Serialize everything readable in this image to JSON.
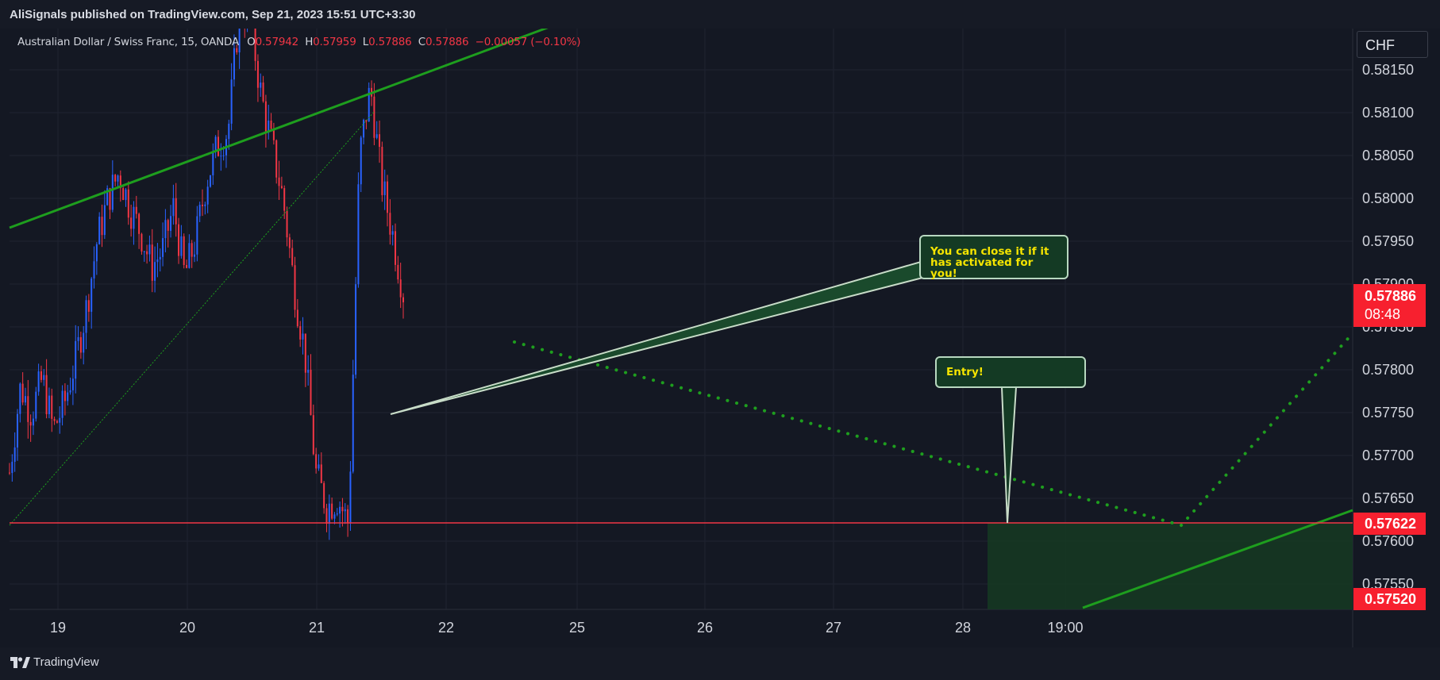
{
  "header": {
    "publisher_text": "AliSignals published on TradingView.com, Sep 21, 2023 15:51 UTC+3:30"
  },
  "legend": {
    "symbol": "Australian Dollar / Swiss Franc, 15, OANDA",
    "o_label": "O",
    "o_value": "0.57942",
    "h_label": "H",
    "h_value": "0.57959",
    "l_label": "L",
    "l_value": "0.57886",
    "c_label": "C",
    "c_value": "0.57886",
    "change": "−0.00057 (−0.10%)"
  },
  "currency": "CHF",
  "price_tags": {
    "last_price": "0.57886",
    "countdown": "08:48",
    "entry_price": "0.57622",
    "stop_price": "0.57520"
  },
  "callouts": {
    "close_note": "You can close it if it has activated for you!",
    "entry_note": "Entry!"
  },
  "footer": {
    "brand": "TradingView"
  },
  "colors": {
    "background": "#141823",
    "candle_up": "#2962ff",
    "candle_down": "#f23645",
    "trendline": "#1e9e1e",
    "horizontal_line": "#f23645",
    "price_tag": "#f7202f",
    "callout_fill": "#143a24",
    "callout_text": "#f5e400",
    "projection_dots": "#1e9e1e",
    "target_zone": "#153a22"
  },
  "chart_data": {
    "type": "candlestick",
    "symbol": "AUDCHF",
    "timeframe": "15",
    "price_axis": {
      "ylim": [
        0.575,
        0.582
      ],
      "ticks": [
        "0.58150",
        "0.58100",
        "0.58050",
        "0.58000",
        "0.57950",
        "0.57900",
        "0.57850",
        "0.57800",
        "0.57750",
        "0.57700",
        "0.57650",
        "0.57600",
        "0.57550"
      ]
    },
    "time_axis": {
      "ticks": [
        "19",
        "20",
        "21",
        "22",
        "25",
        "26",
        "27",
        "28",
        "19:00"
      ]
    },
    "price_path": [
      0.5768,
      0.5778,
      0.5775,
      0.5779,
      0.5773,
      0.5776,
      0.5781,
      0.5787,
      0.5795,
      0.58,
      0.5803,
      0.5799,
      0.5796,
      0.5792,
      0.5794,
      0.5799,
      0.5791,
      0.5795,
      0.5802,
      0.5806,
      0.5808,
      0.5822,
      0.5821,
      0.5812,
      0.5806,
      0.58,
      0.579,
      0.5782,
      0.5768,
      0.5764,
      0.5765,
      0.5762,
      0.5805,
      0.5813,
      0.5802,
      0.5796,
      0.5789
    ],
    "horizontal_level": 0.57622,
    "target_zone": [
      0.5752,
      0.57622
    ],
    "last_price": 0.57886
  }
}
